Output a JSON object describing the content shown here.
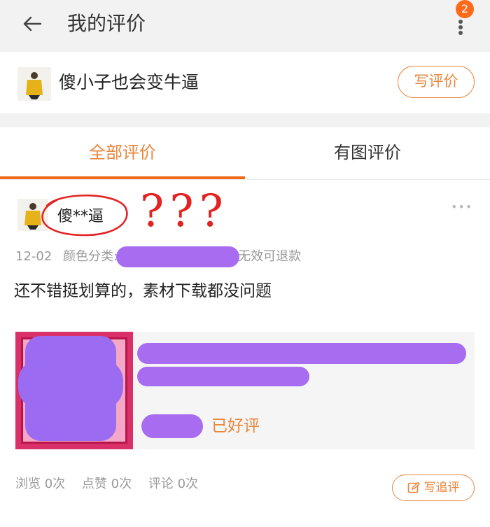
{
  "header": {
    "title": "我的评价",
    "badge_count": "2"
  },
  "shop": {
    "name": "傻小子也会变牛逼",
    "write_review_label": "写评价"
  },
  "tabs": [
    {
      "label": "全部评价",
      "active": true
    },
    {
      "label": "有图评价",
      "active": false
    }
  ],
  "review": {
    "user_name": "傻**逼",
    "question_marks": "???",
    "date": "12-02",
    "spec_label": "颜色分类:",
    "refund_note": "无效可退款",
    "content": "还不错挺划算的，素材下载都没问题",
    "status": "已好评",
    "stats": {
      "views": "浏览 0次",
      "likes": "点赞 0次",
      "comments": "评论 0次"
    },
    "follow_up_label": "写追评"
  },
  "colors": {
    "accent": "#e8873f",
    "tab_underline": "#f06a1a",
    "badge": "#ff6a1a",
    "scribble": "#a86cf0",
    "annotation_red": "#e32222"
  }
}
